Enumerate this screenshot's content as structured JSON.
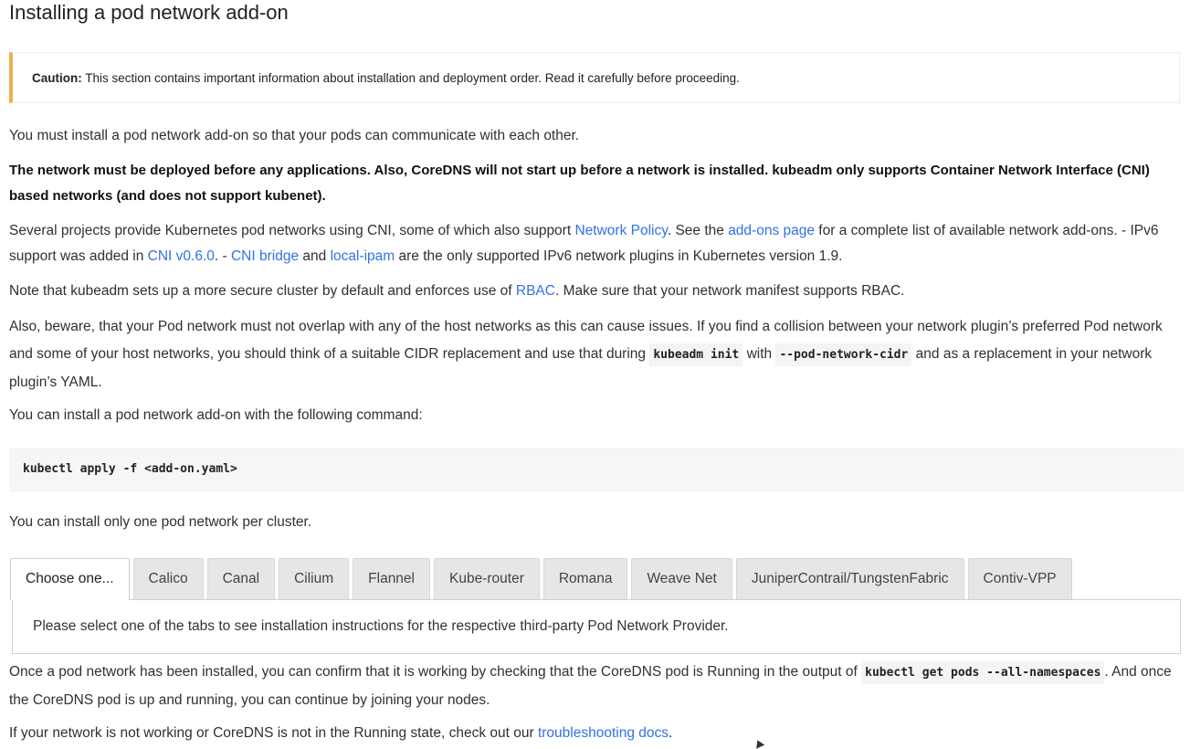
{
  "title": "Installing a pod network add-on",
  "caution": {
    "label": "Caution:",
    "text": " This section contains important information about installation and deployment order. Read it carefully before proceeding."
  },
  "p1": "You must install a pod network add-on so that your pods can communicate with each other.",
  "p2": "The network must be deployed before any applications. Also, CoreDNS will not start up before a network is installed. kubeadm only supports Container Network Interface (CNI) based networks (and does not support kubenet).",
  "p3": {
    "t1": "Several projects provide Kubernetes pod networks using CNI, some of which also support ",
    "link_network_policy": "Network Policy",
    "t2": ". See the ",
    "link_addons": "add-ons page",
    "t3": " for a complete list of available network add-ons. - IPv6 support was added in ",
    "link_cni": "CNI v0.6.0",
    "t4": ". - ",
    "link_bridge": "CNI bridge",
    "t5": " and ",
    "link_ipam": "local-ipam",
    "t6": " are the only supported IPv6 network plugins in Kubernetes version 1.9."
  },
  "p4": {
    "t1": "Note that kubeadm sets up a more secure cluster by default and enforces use of ",
    "link_rbac": "RBAC",
    "t2": ". Make sure that your network manifest supports RBAC."
  },
  "p5": {
    "t1": "Also, beware, that your Pod network must not overlap with any of the host networks as this can cause issues. If you find a collision between your network plugin’s preferred Pod network and some of your host networks, you should think of a suitable CIDR replacement and use that during ",
    "code1": "kubeadm init",
    "t2": " with ",
    "code2": "--pod-network-cidr",
    "t3": " and as a replacement in your network plugin’s YAML."
  },
  "p6": "You can install a pod network add-on with the following command:",
  "command": "kubectl apply -f <add-on.yaml>",
  "p7": "You can install only one pod network per cluster.",
  "tabs": [
    {
      "label": "Choose one..."
    },
    {
      "label": "Calico"
    },
    {
      "label": "Canal"
    },
    {
      "label": "Cilium"
    },
    {
      "label": "Flannel"
    },
    {
      "label": "Kube-router"
    },
    {
      "label": "Romana"
    },
    {
      "label": "Weave Net"
    },
    {
      "label": "JuniperContrail/TungstenFabric"
    },
    {
      "label": "Contiv-VPP"
    }
  ],
  "tab_panel_text": "Please select one of the tabs to see installation instructions for the respective third-party Pod Network Provider.",
  "p8": {
    "t1": "Once a pod network has been installed, you can confirm that it is working by checking that the CoreDNS pod is Running in the output of ",
    "code": "kubectl get pods --all-namespaces",
    "t2": ". And once the CoreDNS pod is up and running, you can continue by joining your nodes."
  },
  "p9": {
    "t1": "If your network is not working or CoreDNS is not in the Running state, check out our ",
    "link": "troubleshooting docs",
    "t2": "."
  },
  "colors": {
    "link": "#3371e3",
    "caution_border": "#f0ad4e",
    "code_bg": "#f4f4f4"
  }
}
